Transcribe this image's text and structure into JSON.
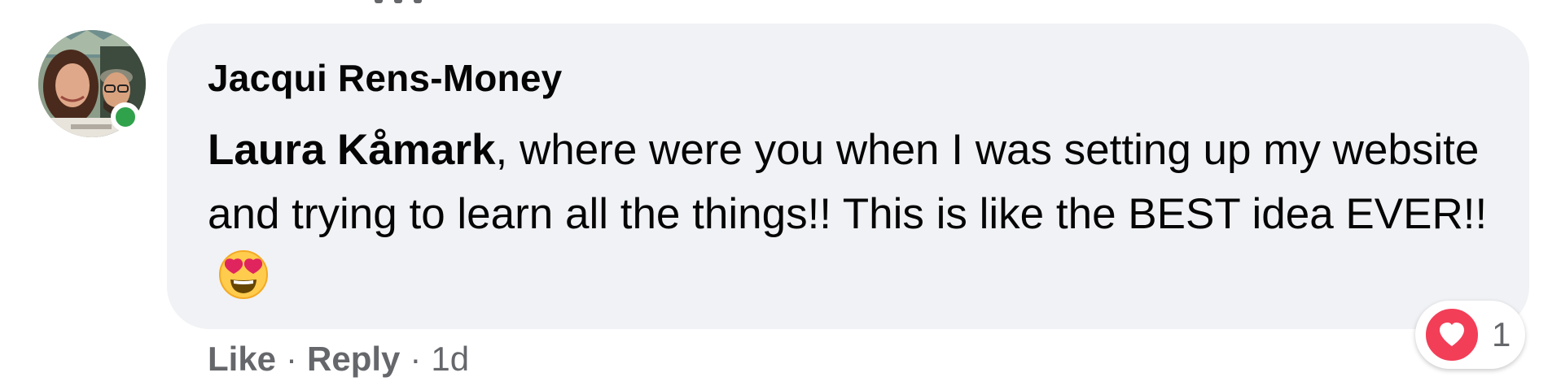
{
  "comment": {
    "author": "Jacqui Rens-Money",
    "mention": "Laura Kåmark",
    "text": ", where were you when I was setting up my website and trying to learn all the things!! This is like the BEST idea EVER!!",
    "emoji": "heart-eyes-emoji",
    "status": "online"
  },
  "actions": {
    "like_label": "Like",
    "separator": "·",
    "reply_label": "Reply",
    "timestamp": "1d"
  },
  "reactions": {
    "icon": "love-icon",
    "count": "1",
    "color": "#f33e58"
  },
  "colors": {
    "bubble": "#f0f2f5",
    "text": "#050505",
    "secondary_text": "#65676b",
    "online": "#31a24c"
  }
}
